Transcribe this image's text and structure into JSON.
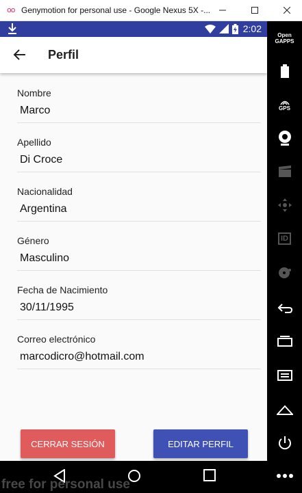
{
  "window": {
    "title": "Genymotion for personal use - Google Nexus 5X -...",
    "logo": "oo"
  },
  "status_bar": {
    "time": "2:02"
  },
  "app_bar": {
    "title": "Perfil"
  },
  "profile": {
    "fields": [
      {
        "label": "Nombre",
        "value": "Marco"
      },
      {
        "label": "Apellido",
        "value": "Di Croce"
      },
      {
        "label": "Nacionalidad",
        "value": "Argentina"
      },
      {
        "label": "Género",
        "value": "Masculino"
      },
      {
        "label": "Fecha de Nacimiento",
        "value": "30/11/1995"
      },
      {
        "label": "Correo electrónico",
        "value": "marcodicro@hotmail.com"
      }
    ]
  },
  "actions": {
    "logout_label": "CERRAR SESIÓN",
    "edit_label": "EDITAR PERFIL"
  },
  "watermark": "free for personal use",
  "side_panel": {
    "opengapps_line1": "Open",
    "opengapps_line2": "GAPPS",
    "gps_label": "GPS",
    "id_label": "ID"
  },
  "colors": {
    "primary_dark": "#303f9f",
    "primary": "#3f51b5",
    "danger": "#e05b5b"
  }
}
